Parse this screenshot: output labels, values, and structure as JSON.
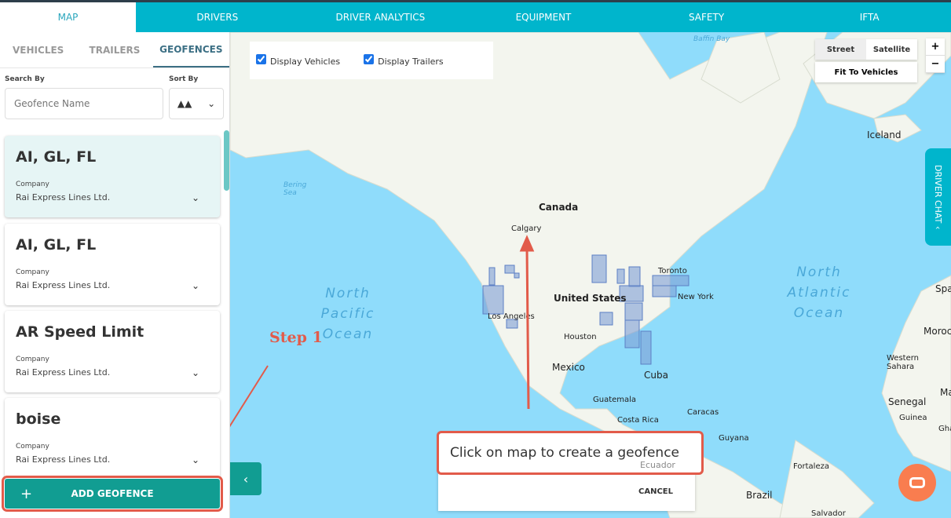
{
  "nav": {
    "tabs": [
      "MAP",
      "DRIVERS",
      "DRIVER ANALYTICS",
      "EQUIPMENT",
      "SAFETY",
      "IFTA"
    ],
    "active": "MAP"
  },
  "sidebar": {
    "subtabs": [
      "VEHICLES",
      "TRAILERS",
      "GEOFENCES"
    ],
    "active_subtab": "GEOFENCES",
    "search_label": "Search By",
    "search_placeholder": "Geofence Name",
    "sort_label": "Sort By",
    "cards": [
      {
        "title": "AI, GL, FL",
        "company_label": "Company",
        "company": "Rai Express Lines Ltd.",
        "selected": true
      },
      {
        "title": "AI, GL, FL",
        "company_label": "Company",
        "company": "Rai Express Lines Ltd."
      },
      {
        "title": "AR Speed Limit",
        "company_label": "Company",
        "company": "Rai Express Lines Ltd."
      },
      {
        "title": "boise",
        "company_label": "Company",
        "company": "Rai Express Lines Ltd."
      }
    ],
    "add_button": "ADD GEOFENCE"
  },
  "map": {
    "display_vehicles": {
      "label": "Display Vehicles",
      "checked": true
    },
    "display_trailers": {
      "label": "Display Trailers",
      "checked": true
    },
    "map_types": [
      "Street",
      "Satellite"
    ],
    "active_map_type": "Street",
    "fit_button": "Fit To Vehicles",
    "zoom_in": "+",
    "zoom_out": "−",
    "driver_chat": "DRIVER CHAT",
    "labels": [
      "Canada",
      "Calgary",
      "United States",
      "Toronto",
      "New York",
      "Los Angeles",
      "Houston",
      "Mexico",
      "Cuba",
      "Guatemala",
      "Costa Rica",
      "Caracas",
      "Guyana",
      "Ecuador",
      "Fortaleza",
      "Brazil",
      "Salvador",
      "Iceland",
      "Spain",
      "Morocco",
      "Western Sahara",
      "Senegal",
      "Guinea",
      "Ghana",
      "Ma",
      "Bering Sea",
      "Baffin Bay"
    ],
    "oceans": [
      "North Pacific Ocean",
      "North Atlantic Ocean"
    ],
    "dialog": {
      "message": "Click on map to create a geofence",
      "cancel": "CANCEL"
    },
    "annotation": "Step 1"
  },
  "colors": {
    "accent": "#00b5cc",
    "button": "#119d92",
    "annotation": "#e25b4a",
    "water": "#8fdcfb"
  }
}
